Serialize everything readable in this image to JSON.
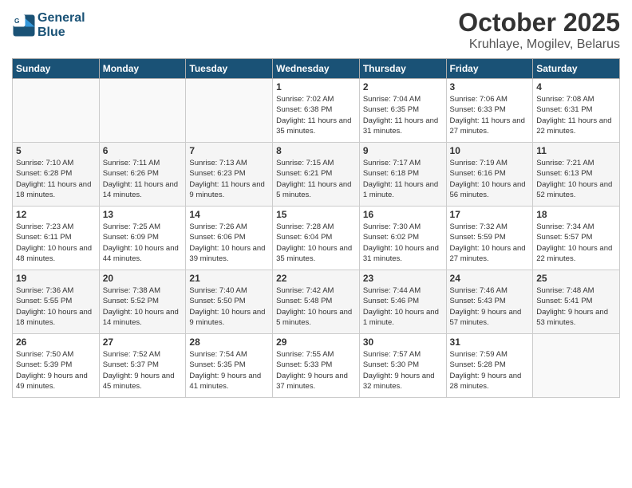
{
  "header": {
    "logo_line1": "General",
    "logo_line2": "Blue",
    "month": "October 2025",
    "location": "Kruhlaye, Mogilev, Belarus"
  },
  "weekdays": [
    "Sunday",
    "Monday",
    "Tuesday",
    "Wednesday",
    "Thursday",
    "Friday",
    "Saturday"
  ],
  "weeks": [
    [
      {
        "day": "",
        "info": ""
      },
      {
        "day": "",
        "info": ""
      },
      {
        "day": "",
        "info": ""
      },
      {
        "day": "1",
        "info": "Sunrise: 7:02 AM\nSunset: 6:38 PM\nDaylight: 11 hours and 35 minutes."
      },
      {
        "day": "2",
        "info": "Sunrise: 7:04 AM\nSunset: 6:35 PM\nDaylight: 11 hours and 31 minutes."
      },
      {
        "day": "3",
        "info": "Sunrise: 7:06 AM\nSunset: 6:33 PM\nDaylight: 11 hours and 27 minutes."
      },
      {
        "day": "4",
        "info": "Sunrise: 7:08 AM\nSunset: 6:31 PM\nDaylight: 11 hours and 22 minutes."
      }
    ],
    [
      {
        "day": "5",
        "info": "Sunrise: 7:10 AM\nSunset: 6:28 PM\nDaylight: 11 hours and 18 minutes."
      },
      {
        "day": "6",
        "info": "Sunrise: 7:11 AM\nSunset: 6:26 PM\nDaylight: 11 hours and 14 minutes."
      },
      {
        "day": "7",
        "info": "Sunrise: 7:13 AM\nSunset: 6:23 PM\nDaylight: 11 hours and 9 minutes."
      },
      {
        "day": "8",
        "info": "Sunrise: 7:15 AM\nSunset: 6:21 PM\nDaylight: 11 hours and 5 minutes."
      },
      {
        "day": "9",
        "info": "Sunrise: 7:17 AM\nSunset: 6:18 PM\nDaylight: 11 hours and 1 minute."
      },
      {
        "day": "10",
        "info": "Sunrise: 7:19 AM\nSunset: 6:16 PM\nDaylight: 10 hours and 56 minutes."
      },
      {
        "day": "11",
        "info": "Sunrise: 7:21 AM\nSunset: 6:13 PM\nDaylight: 10 hours and 52 minutes."
      }
    ],
    [
      {
        "day": "12",
        "info": "Sunrise: 7:23 AM\nSunset: 6:11 PM\nDaylight: 10 hours and 48 minutes."
      },
      {
        "day": "13",
        "info": "Sunrise: 7:25 AM\nSunset: 6:09 PM\nDaylight: 10 hours and 44 minutes."
      },
      {
        "day": "14",
        "info": "Sunrise: 7:26 AM\nSunset: 6:06 PM\nDaylight: 10 hours and 39 minutes."
      },
      {
        "day": "15",
        "info": "Sunrise: 7:28 AM\nSunset: 6:04 PM\nDaylight: 10 hours and 35 minutes."
      },
      {
        "day": "16",
        "info": "Sunrise: 7:30 AM\nSunset: 6:02 PM\nDaylight: 10 hours and 31 minutes."
      },
      {
        "day": "17",
        "info": "Sunrise: 7:32 AM\nSunset: 5:59 PM\nDaylight: 10 hours and 27 minutes."
      },
      {
        "day": "18",
        "info": "Sunrise: 7:34 AM\nSunset: 5:57 PM\nDaylight: 10 hours and 22 minutes."
      }
    ],
    [
      {
        "day": "19",
        "info": "Sunrise: 7:36 AM\nSunset: 5:55 PM\nDaylight: 10 hours and 18 minutes."
      },
      {
        "day": "20",
        "info": "Sunrise: 7:38 AM\nSunset: 5:52 PM\nDaylight: 10 hours and 14 minutes."
      },
      {
        "day": "21",
        "info": "Sunrise: 7:40 AM\nSunset: 5:50 PM\nDaylight: 10 hours and 9 minutes."
      },
      {
        "day": "22",
        "info": "Sunrise: 7:42 AM\nSunset: 5:48 PM\nDaylight: 10 hours and 5 minutes."
      },
      {
        "day": "23",
        "info": "Sunrise: 7:44 AM\nSunset: 5:46 PM\nDaylight: 10 hours and 1 minute."
      },
      {
        "day": "24",
        "info": "Sunrise: 7:46 AM\nSunset: 5:43 PM\nDaylight: 9 hours and 57 minutes."
      },
      {
        "day": "25",
        "info": "Sunrise: 7:48 AM\nSunset: 5:41 PM\nDaylight: 9 hours and 53 minutes."
      }
    ],
    [
      {
        "day": "26",
        "info": "Sunrise: 7:50 AM\nSunset: 5:39 PM\nDaylight: 9 hours and 49 minutes."
      },
      {
        "day": "27",
        "info": "Sunrise: 7:52 AM\nSunset: 5:37 PM\nDaylight: 9 hours and 45 minutes."
      },
      {
        "day": "28",
        "info": "Sunrise: 7:54 AM\nSunset: 5:35 PM\nDaylight: 9 hours and 41 minutes."
      },
      {
        "day": "29",
        "info": "Sunrise: 7:55 AM\nSunset: 5:33 PM\nDaylight: 9 hours and 37 minutes."
      },
      {
        "day": "30",
        "info": "Sunrise: 7:57 AM\nSunset: 5:30 PM\nDaylight: 9 hours and 32 minutes."
      },
      {
        "day": "31",
        "info": "Sunrise: 7:59 AM\nSunset: 5:28 PM\nDaylight: 9 hours and 28 minutes."
      },
      {
        "day": "",
        "info": ""
      }
    ]
  ]
}
